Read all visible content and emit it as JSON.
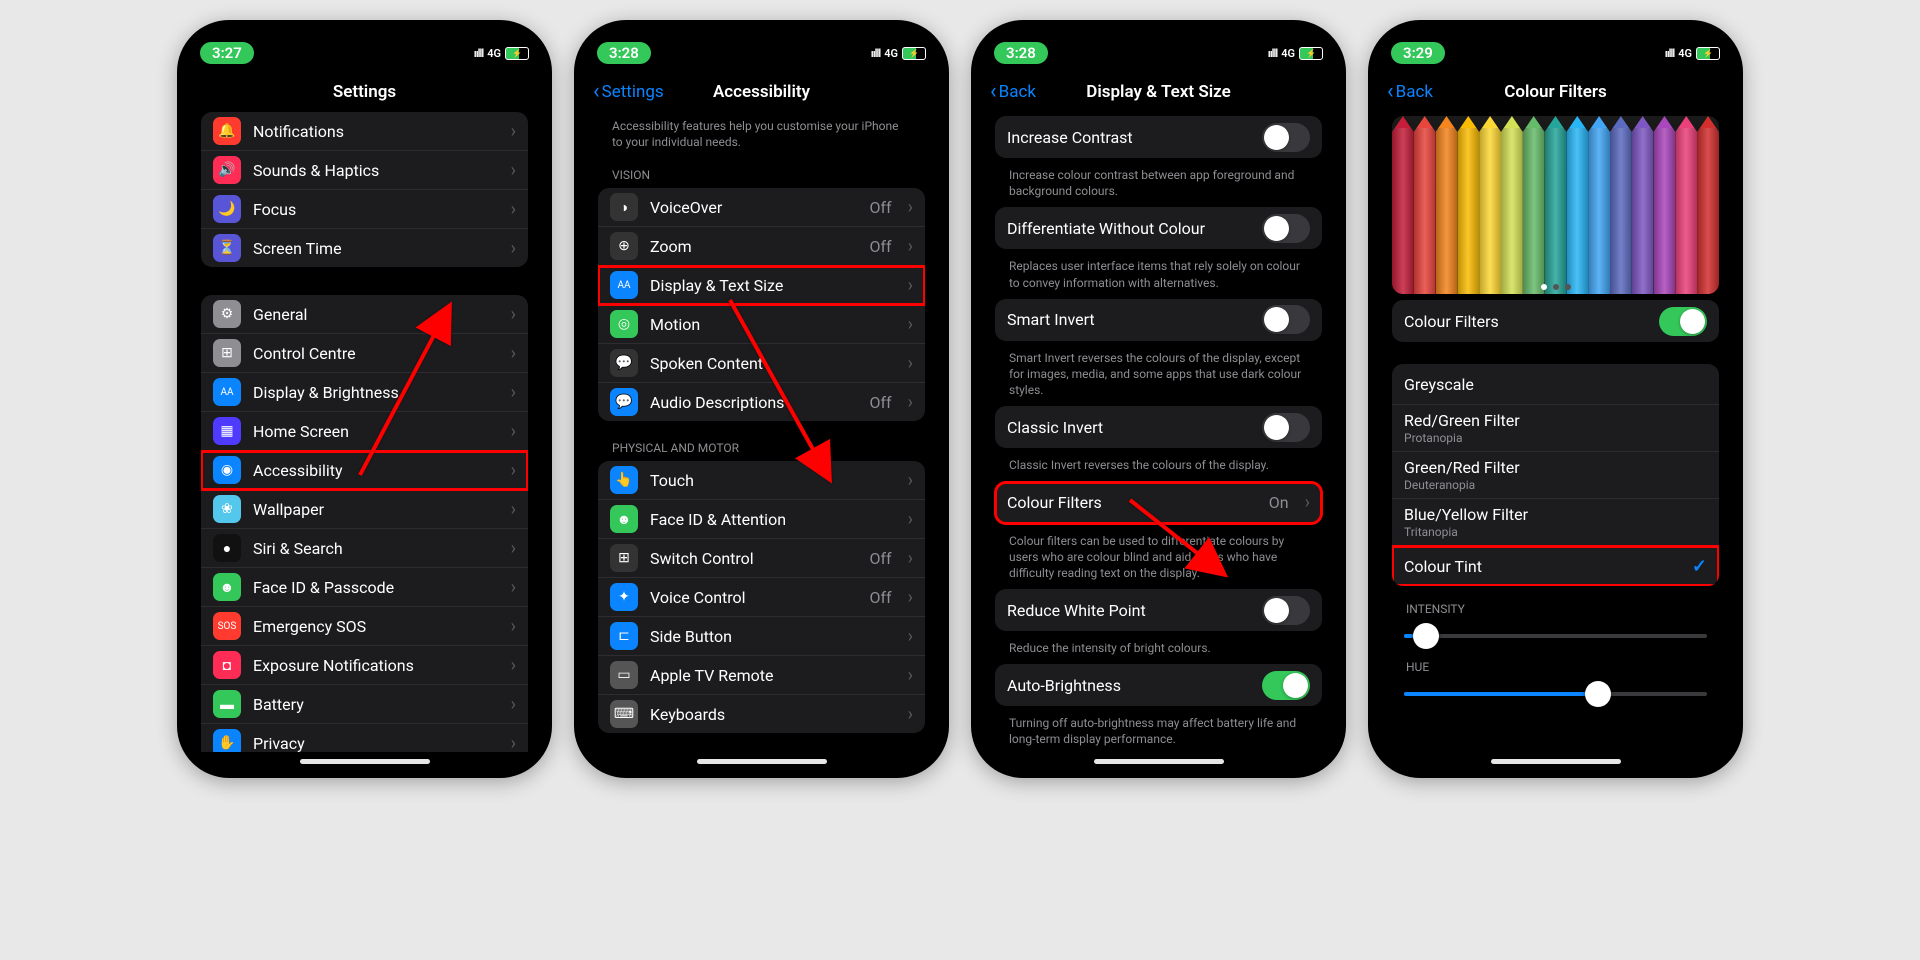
{
  "status": {
    "net": "4G",
    "signal": "ıılll",
    "batt": "⚡"
  },
  "times": [
    "3:27",
    "3:28",
    "3:28",
    "3:29"
  ],
  "screen1": {
    "title": "Settings",
    "group1": [
      {
        "icon": "🔔",
        "bg": "#ff3b30",
        "label": "Notifications"
      },
      {
        "icon": "🔊",
        "bg": "#ff2d55",
        "label": "Sounds & Haptics"
      },
      {
        "icon": "🌙",
        "bg": "#5856d6",
        "label": "Focus"
      },
      {
        "icon": "⏳",
        "bg": "#5856d6",
        "label": "Screen Time"
      }
    ],
    "group2": [
      {
        "icon": "⚙",
        "bg": "#8e8e93",
        "label": "General"
      },
      {
        "icon": "⊞",
        "bg": "#8e8e93",
        "label": "Control Centre"
      },
      {
        "icon": "AA",
        "bg": "#0a84ff",
        "label": "Display & Brightness",
        "small": true
      },
      {
        "icon": "▦",
        "bg": "#4f3bff",
        "label": "Home Screen"
      },
      {
        "icon": "◉",
        "bg": "#0a84ff",
        "label": "Accessibility",
        "hl": true
      },
      {
        "icon": "❀",
        "bg": "#54c7ec",
        "label": "Wallpaper"
      },
      {
        "icon": "●",
        "bg": "#111",
        "label": "Siri & Search"
      },
      {
        "icon": "☻",
        "bg": "#34c759",
        "label": "Face ID & Passcode"
      },
      {
        "icon": "SOS",
        "bg": "#ff3b30",
        "label": "Emergency SOS",
        "small": true
      },
      {
        "icon": "◘",
        "bg": "#ff2d55",
        "label": "Exposure Notifications"
      },
      {
        "icon": "▬",
        "bg": "#34c759",
        "label": "Battery"
      },
      {
        "icon": "✋",
        "bg": "#0a84ff",
        "label": "Privacy"
      }
    ]
  },
  "screen2": {
    "back": "Settings",
    "title": "Accessibility",
    "desc": "Accessibility features help you customise your iPhone to your individual needs.",
    "h1": "VISION",
    "vision": [
      {
        "icon": "◑",
        "bg": "#333",
        "label": "VoiceOver",
        "val": "Off"
      },
      {
        "icon": "⊕",
        "bg": "#333",
        "label": "Zoom",
        "val": "Off"
      },
      {
        "icon": "AA",
        "bg": "#0a84ff",
        "label": "Display & Text Size",
        "hl": true,
        "small": true
      },
      {
        "icon": "◎",
        "bg": "#34c759",
        "label": "Motion"
      },
      {
        "icon": "💬",
        "bg": "#333",
        "label": "Spoken Content"
      },
      {
        "icon": "💬",
        "bg": "#0a84ff",
        "label": "Audio Descriptions",
        "val": "Off"
      }
    ],
    "h2": "PHYSICAL AND MOTOR",
    "motor": [
      {
        "icon": "👆",
        "bg": "#0a84ff",
        "label": "Touch"
      },
      {
        "icon": "☻",
        "bg": "#34c759",
        "label": "Face ID & Attention"
      },
      {
        "icon": "⊞",
        "bg": "#333",
        "label": "Switch Control",
        "val": "Off"
      },
      {
        "icon": "✦",
        "bg": "#0a84ff",
        "label": "Voice Control",
        "val": "Off"
      },
      {
        "icon": "⊏",
        "bg": "#0a84ff",
        "label": "Side Button"
      },
      {
        "icon": "▭",
        "bg": "#555",
        "label": "Apple TV Remote"
      },
      {
        "icon": "⌨",
        "bg": "#555",
        "label": "Keyboards"
      }
    ]
  },
  "screen3": {
    "back": "Back",
    "title": "Display & Text Size",
    "rows": [
      {
        "label": "Increase Contrast",
        "toggle": false,
        "desc": "Increase colour contrast between app foreground and background colours."
      },
      {
        "label": "Differentiate Without Colour",
        "toggle": false,
        "desc": "Replaces user interface items that rely solely on colour to convey information with alternatives."
      },
      {
        "label": "Smart Invert",
        "toggle": false,
        "desc": "Smart Invert reverses the colours of the display, except for images, media, and some apps that use dark colour styles."
      },
      {
        "label": "Classic Invert",
        "toggle": false,
        "desc": "Classic Invert reverses the colours of the display."
      },
      {
        "label": "Colour Filters",
        "value": "On",
        "hl": true,
        "desc": "Colour filters can be used to differentiate colours by users who are colour blind and aid users who have difficulty reading text on the display."
      },
      {
        "label": "Reduce White Point",
        "toggle": false,
        "desc": "Reduce the intensity of bright colours."
      },
      {
        "label": "Auto-Brightness",
        "toggle": true,
        "desc": "Turning off auto-brightness may affect battery life and long-term display performance."
      }
    ]
  },
  "screen4": {
    "back": "Back",
    "title": "Colour Filters",
    "toggle_label": "Colour Filters",
    "options": [
      {
        "label": "Greyscale"
      },
      {
        "label": "Red/Green Filter",
        "sub": "Protanopia"
      },
      {
        "label": "Green/Red Filter",
        "sub": "Deuteranopia"
      },
      {
        "label": "Blue/Yellow Filter",
        "sub": "Tritanopia"
      },
      {
        "label": "Colour Tint",
        "check": true,
        "hl": true
      }
    ],
    "h_int": "INTENSITY",
    "h_hue": "HUE",
    "intensity": 3,
    "hue": 64,
    "pencil_colors": [
      "#c41e3a",
      "#e8453c",
      "#f5851f",
      "#fbbc04",
      "#fdd835",
      "#d4e157",
      "#66bb6a",
      "#26a69a",
      "#29b6f6",
      "#42a5f5",
      "#5c6bc0",
      "#7e57c2",
      "#ab47bc",
      "#ec407a",
      "#d32f2f"
    ]
  }
}
